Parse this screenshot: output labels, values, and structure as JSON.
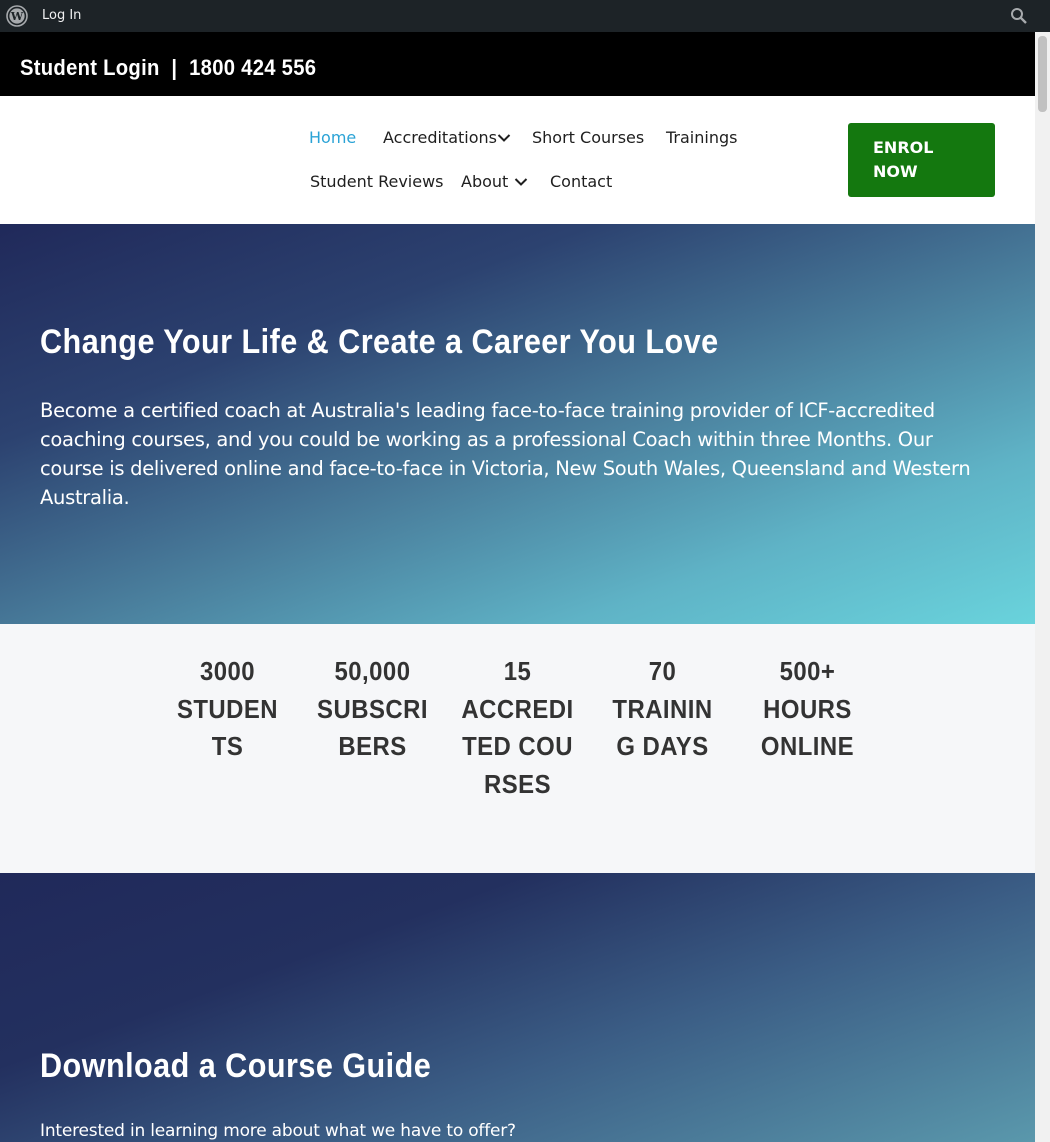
{
  "admin_bar": {
    "logo_icon": "wordpress-icon",
    "login_label": "Log In",
    "search_icon": "search-icon",
    "background": "#1d2327"
  },
  "top_bar": {
    "contact_text": "Student Login  |  1800 424 556"
  },
  "nav": {
    "items": [
      {
        "label": "Home",
        "active": true
      },
      {
        "label": "Accreditations",
        "has_dropdown": true
      },
      {
        "label": "Short Courses"
      },
      {
        "label": "Trainings"
      },
      {
        "label": "Student Reviews"
      },
      {
        "label": "About",
        "has_dropdown": true
      },
      {
        "label": "Contact"
      }
    ],
    "cta_label": "ENROL NOW",
    "active_color": "#2ba3d6",
    "cta_color": "#14780f"
  },
  "hero": {
    "title": "Change Your Life & Create a Career You Love",
    "text": "Become a certified coach at Australia's leading face-to-face training provider of ICF-accredited coaching courses, and you could be working as a professional Coach within three Months. Our course is delivered online and face-to-face in Victoria, New South Wales, Queensland and Western Australia."
  },
  "stats": [
    {
      "value": "3000",
      "label": "STUDENTS"
    },
    {
      "value": "50,000",
      "label": "SUBSCRIBERS"
    },
    {
      "value": "15",
      "label": "ACCREDITED COURSES"
    },
    {
      "value": "70",
      "label": "TRAINING DAYS"
    },
    {
      "value": "500+",
      "label": "HOURS ONLINE"
    }
  ],
  "guide": {
    "title": "Download a Course Guide",
    "text": "Interested in learning more about what we have to offer?"
  }
}
